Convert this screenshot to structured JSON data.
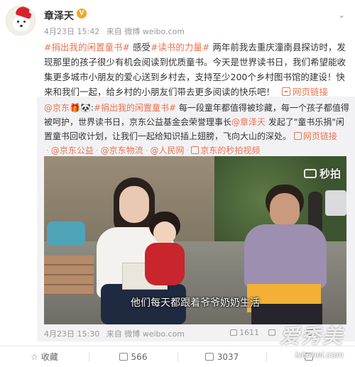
{
  "post": {
    "username": "章泽天",
    "vip_badge": "V",
    "time": "4月23日 15:42",
    "source": "来自 微博 weibo.com",
    "text": {
      "tag1": "#捐出我的闲置童书#",
      "t1": " 感受",
      "tag2": "#读书的力量#",
      "t2": " 两年前我去重庆潼南县探访时，发现那里的孩子很少有机会阅读到优质童书。今天是世界读书日，我们希望能收集更多城市小朋友的爱心送到乡村去，支持至少200个乡村图书馆的建设！快来和我们一起，给乡村的小朋友们带去更多阅读的快乐吧！",
      "link": "网页链接"
    }
  },
  "repost": {
    "author": "@京东",
    "author_badges": "🎁🐼",
    "tag": "#捐出我的闲置童书#",
    "t1": " 每一段童年都值得被珍藏，每一个孩子都值得被呵护，世界读书日，京东公益基金会荣誉理事长",
    "mention": "@章泽天",
    "t2": " 发起了\"童书乐捐\"闲置童书回收计划，让我们一起给知识插上翅膀，飞向大山的深处。",
    "links": [
      "网页链接",
      "@京东公益",
      "@京东物流",
      "@人民网",
      "京东的秒拍视频"
    ],
    "video": {
      "watermark": "秒拍",
      "subtitle": "他们每天都跟着爷爷奶奶生活"
    },
    "time": "4月23日 15:30",
    "source": "来自 微博 weibo.com",
    "stats": {
      "share": "1611",
      "comment": "",
      "like": ""
    }
  },
  "actions": {
    "favorite": "收藏",
    "repost": "566",
    "comment": "3037",
    "like": ""
  },
  "site_watermark": {
    "cn": "爱秀美",
    "en": "ixiumei.com"
  }
}
